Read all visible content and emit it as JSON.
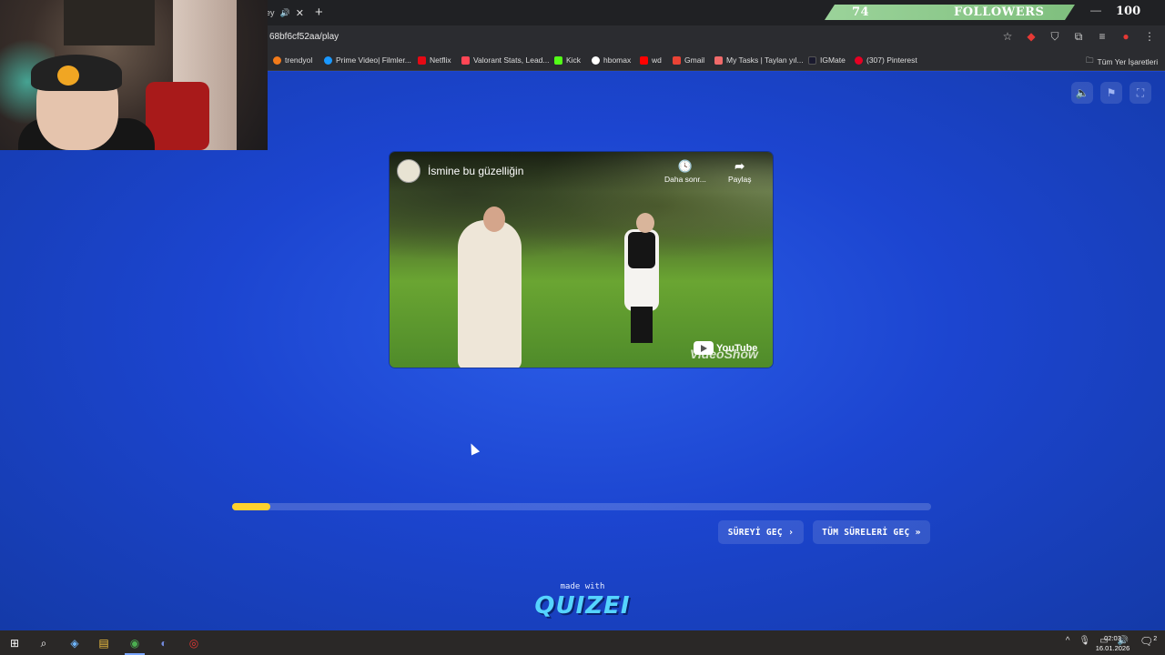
{
  "browser": {
    "tab_title": "ley",
    "url": "68bf6cf52aa/play",
    "bookmarks": [
      {
        "label": "trendyol",
        "color": "#f27a1a"
      },
      {
        "label": "Prime Video| Filmler...",
        "color": "#1a98ff"
      },
      {
        "label": "Netflix",
        "color": "#e50914"
      },
      {
        "label": "Valorant Stats, Lead...",
        "color": "#ff4655"
      },
      {
        "label": "Kick",
        "color": "#53fc18"
      },
      {
        "label": "hbomax",
        "color": "#ffffff"
      },
      {
        "label": "wd",
        "color": "#ff0000"
      },
      {
        "label": "Gmail",
        "color": "#ea4335"
      },
      {
        "label": "My Tasks | Taylan yıl...",
        "color": "#f06a6a"
      },
      {
        "label": "IGMate",
        "color": "#1a1a2e"
      },
      {
        "label": "(307) Pinterest",
        "color": "#e60023"
      }
    ],
    "all_bookmarks": "Tüm Yer İşaretleri"
  },
  "overlay": {
    "followers_count": "74",
    "followers_label": "FOLLOWERS",
    "followers_goal": "100"
  },
  "video": {
    "title": "İsmine bu güzelliğin",
    "watch_later": "Daha sonr...",
    "share": "Paylaş",
    "youtube": "YouTube",
    "watermark": "VideoShow"
  },
  "quiz": {
    "progress_percent": 5.5,
    "skip_label": "SÜREYİ GEÇ",
    "skip_all_label": "TÜM SÜRELERİ GEÇ",
    "made_with": "made with",
    "brand": "QUIZEI"
  },
  "taskbar": {
    "time": "02:03",
    "date": "16.01.2026",
    "notification_count": "2"
  }
}
